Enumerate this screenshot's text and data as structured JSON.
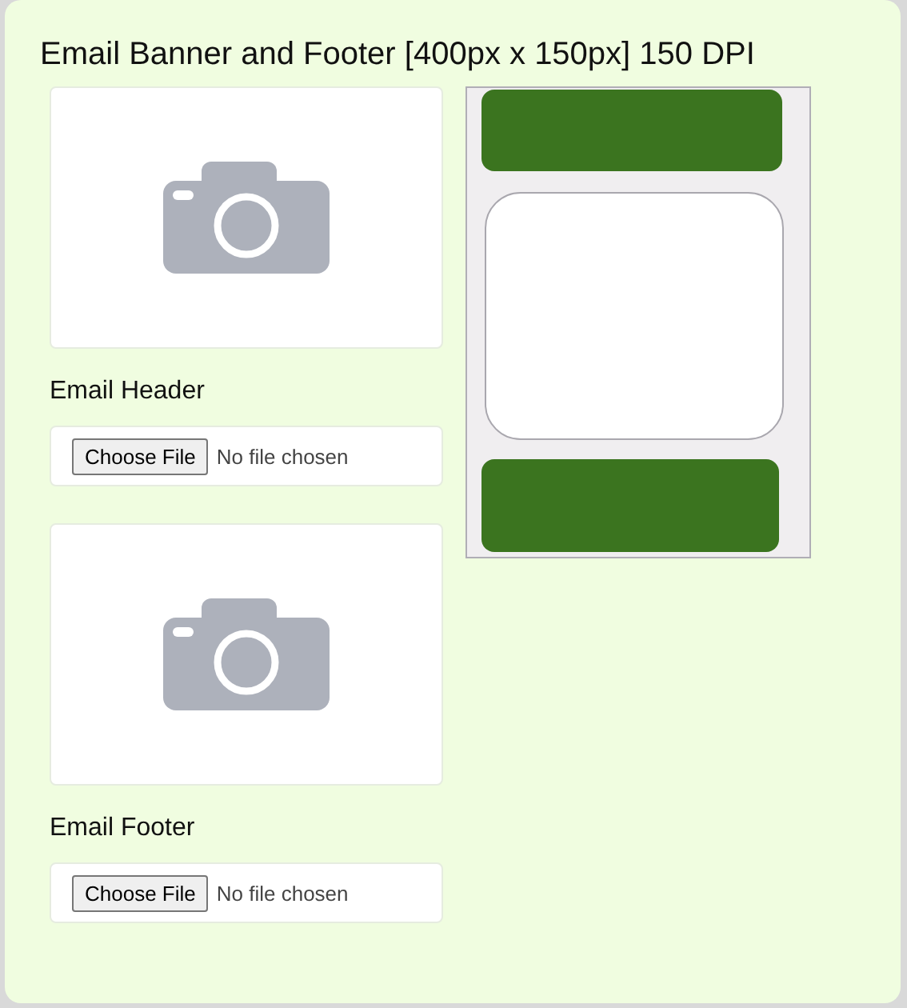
{
  "title": "Email Banner and Footer [400px x 150px] 150 DPI",
  "uploads": [
    {
      "label": "Email Header",
      "button": "Choose File",
      "status": "No file chosen"
    },
    {
      "label": "Email Footer",
      "button": "Choose File",
      "status": "No file chosen"
    }
  ]
}
